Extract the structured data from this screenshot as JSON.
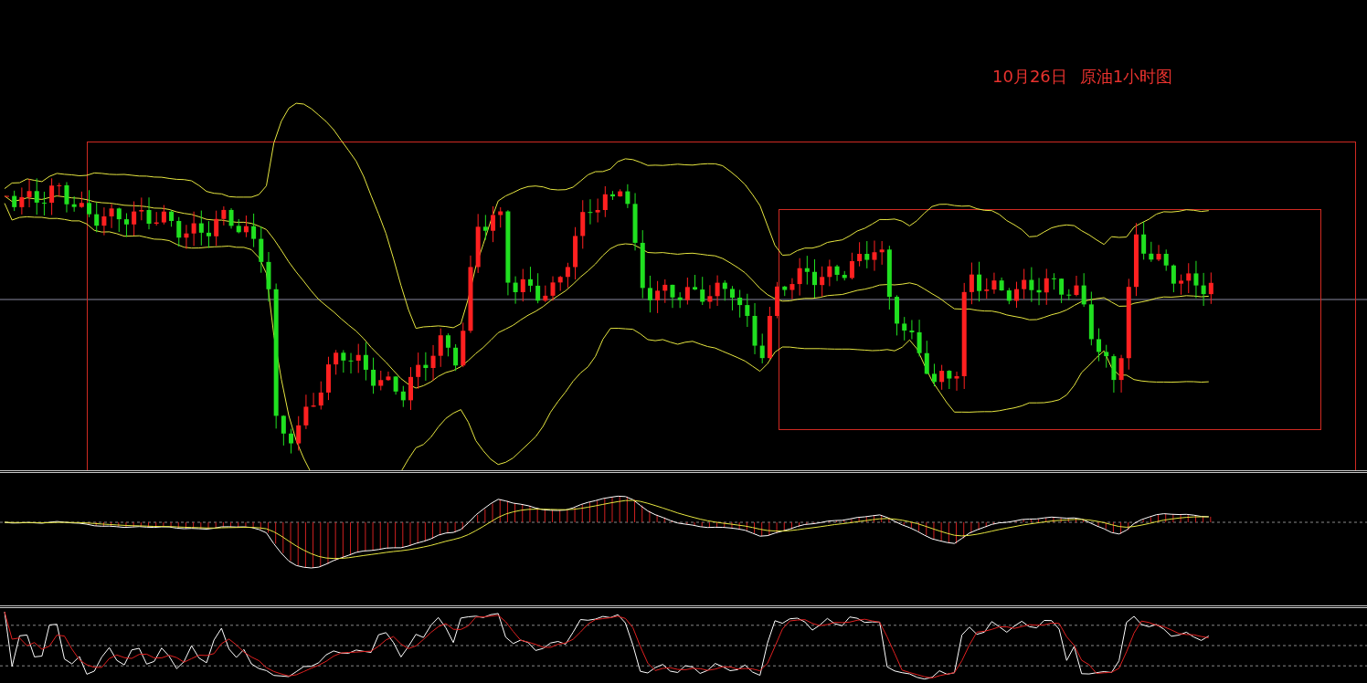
{
  "chart_title": {
    "date": "10月26日",
    "name": "原油1小时图"
  }
}
